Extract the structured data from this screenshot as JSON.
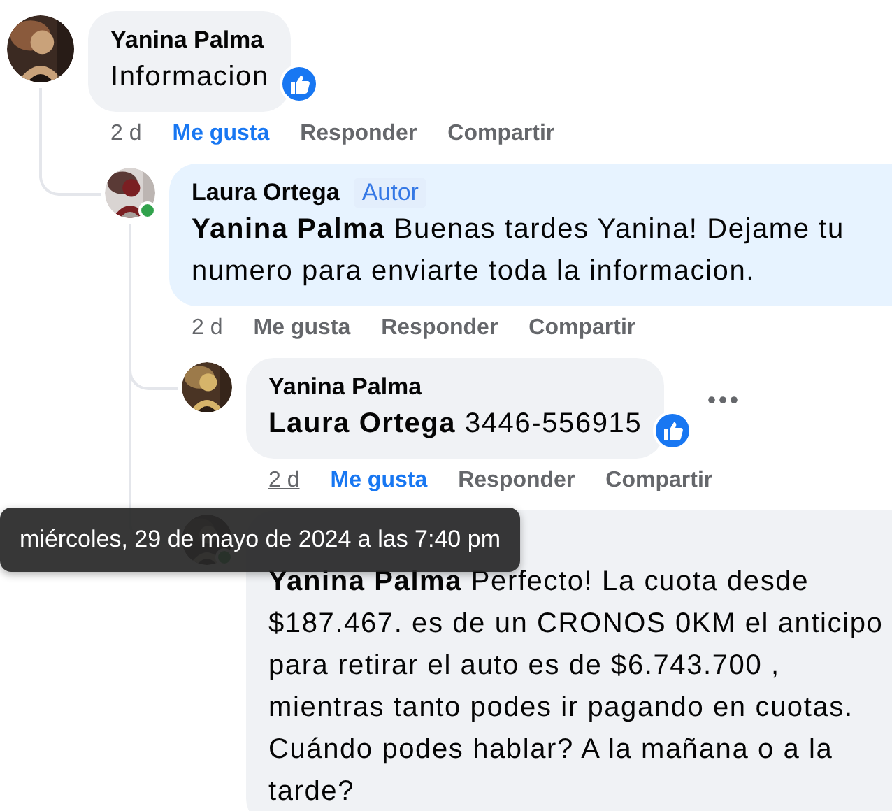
{
  "comments": [
    {
      "author": "Yanina Palma",
      "online": false,
      "highlighted": false,
      "body": "Informacion",
      "reacted": true,
      "more_menu": false,
      "time": "2 d",
      "time_hovered": false,
      "actions": [
        {
          "label": "Me gusta",
          "selected": true
        },
        {
          "label": "Responder",
          "selected": false
        },
        {
          "label": "Compartir",
          "selected": false
        }
      ],
      "children": [
        {
          "author": "Laura Ortega",
          "author_badge": "Autor",
          "online": true,
          "highlighted": true,
          "body": "**Yanina Palma** Buenas tardes Yanina! Dejame tu numero para enviarte toda la informacion.",
          "reacted": false,
          "more_menu": false,
          "time": "2 d",
          "time_hovered": false,
          "actions": [
            {
              "label": "Me gusta",
              "selected": false
            },
            {
              "label": "Responder",
              "selected": false
            },
            {
              "label": "Compartir",
              "selected": false
            }
          ],
          "children": [
            {
              "author": "Yanina Palma",
              "online": false,
              "highlighted": false,
              "body": "**Laura Ortega** 3446-556915",
              "reacted": true,
              "more_menu": true,
              "time": "2 d",
              "time_hovered": true,
              "actions": [
                {
                  "label": "Me gusta",
                  "selected": true
                },
                {
                  "label": "Responder",
                  "selected": false
                },
                {
                  "label": "Compartir",
                  "selected": false
                }
              ]
            },
            {
              "online": true,
              "highlighted": false,
              "body": "**Yanina Palma** Perfecto! La cuota desde $187.467. es de un CRONOS 0KM el anticipo para retirar el auto es de $6.743.700 , mientras tanto podes ir pagando en cuotas. Cuándo podes hablar? A la mañana o a la tarde?",
              "reacted": false,
              "more_menu": false
            }
          ]
        }
      ]
    }
  ],
  "tooltip": {
    "text": "miércoles, 29 de mayo de 2024 a las 7:40 pm"
  }
}
